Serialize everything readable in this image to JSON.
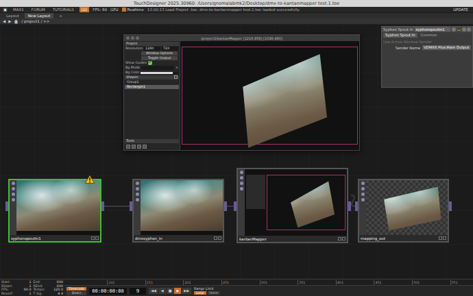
{
  "title_bar": {
    "title": "TouchDesigner 2025.30960: /Users/gnomalabmk2/Desktop/dmx-to-kantanmapper test.1.toe"
  },
  "menu_bar": {
    "items": [
      {
        "label": "MAX1",
        "selected": false
      },
      {
        "label": "FORUM",
        "selected": false
      },
      {
        "label": "TUTORIALS",
        "selected": false
      },
      {
        "label": "GO",
        "selected": true
      }
    ],
    "fps": "FPS: 60",
    "gpu": "GPU",
    "realtime": {
      "label": "Realtime",
      "checked": true
    },
    "message": "13:00:13 Load Project .toe: dmx-to-kantanmapper test.1.toe loaded successfully.",
    "update": "UPDATE"
  },
  "layout_bar": {
    "tabs": [
      {
        "label": "Layout",
        "selected": false
      },
      {
        "label": "New Layout",
        "selected": true
      }
    ],
    "add": "+"
  },
  "path_bar": {
    "back": "◀",
    "forward": "▶",
    "path": "/ project1 / >>"
  },
  "kantan_window": {
    "title": "/project1/kantanMapper [1216,856] [1026,480]",
    "section": "Project",
    "resolution_label": "Resolution",
    "width": "1280",
    "height": "720",
    "buttons": [
      "Window Options",
      "Toggle Output"
    ],
    "show_guides": {
      "label": "Show Guides",
      "checked": true
    },
    "bg_mode": {
      "label": "Bg Mode",
      "clear": "×"
    },
    "bg_color": {
      "label": "Bg Color",
      "level": 0.85
    },
    "shapes_label": "Shapes",
    "shapes": [
      {
        "label": "Group1",
        "selected": false
      },
      {
        "label": "Rectangle1",
        "selected": true
      }
    ],
    "tools_label": "Tools"
  },
  "param_panel": {
    "op_type": "Syphon Spout In",
    "op_name": "syphonspoutin1",
    "warning": true,
    "tabs": [
      {
        "label": "Syphon Spout In",
        "selected": true
      },
      {
        "label": "Common",
        "selected": false
      }
    ],
    "rows": [
      {
        "label": "Use Active Window Sender",
        "value": "",
        "disabled": true
      },
      {
        "label": "Sender Name",
        "value": "VDMX6 Plus:Main Output",
        "disabled": false
      }
    ]
  },
  "nodes": [
    {
      "name": "syphonspoutin1",
      "kind": "image",
      "selected": true,
      "warning": true
    },
    {
      "name": "dmxsyphon_in",
      "kind": "image",
      "selected": false,
      "warning": false
    },
    {
      "name": "kantanMapper",
      "kind": "mapper",
      "selected": false,
      "warning": false
    },
    {
      "name": "mapping_out",
      "kind": "checker",
      "selected": false,
      "warning": false
    }
  ],
  "timeline": {
    "fields": [
      {
        "label": "Start:",
        "value": "1"
      },
      {
        "label": "End:",
        "value": "600"
      },
      {
        "label": "RStart:",
        "value": "1"
      },
      {
        "label": "REnd:",
        "value": "600"
      },
      {
        "label": "FPS:",
        "value": "60.0"
      },
      {
        "label": "Tempo:",
        "value": "120.0"
      },
      {
        "label": "ResetF:",
        "value": "1"
      },
      {
        "label": "T Sig:",
        "value": "4   4"
      }
    ],
    "modes": [
      {
        "label": "Timecode",
        "selected": true
      },
      {
        "label": "Beats",
        "selected": false
      }
    ],
    "timecode": "00:00:00:08",
    "frame": "9",
    "transport": [
      {
        "label": "◀◀",
        "selected": false
      },
      {
        "label": "◀",
        "selected": false
      },
      {
        "label": "■",
        "selected": false
      },
      {
        "label": "▶",
        "selected": true
      },
      {
        "label": "▶▶",
        "selected": false
      }
    ],
    "range_label": "Range Limit",
    "ranges": [
      {
        "label": "Loop",
        "selected": true
      },
      {
        "label": "Once",
        "selected": false
      }
    ],
    "ruler": [
      "101",
      "151",
      "201",
      "251",
      "301",
      "351",
      "401",
      "451",
      "501",
      "551"
    ]
  }
}
